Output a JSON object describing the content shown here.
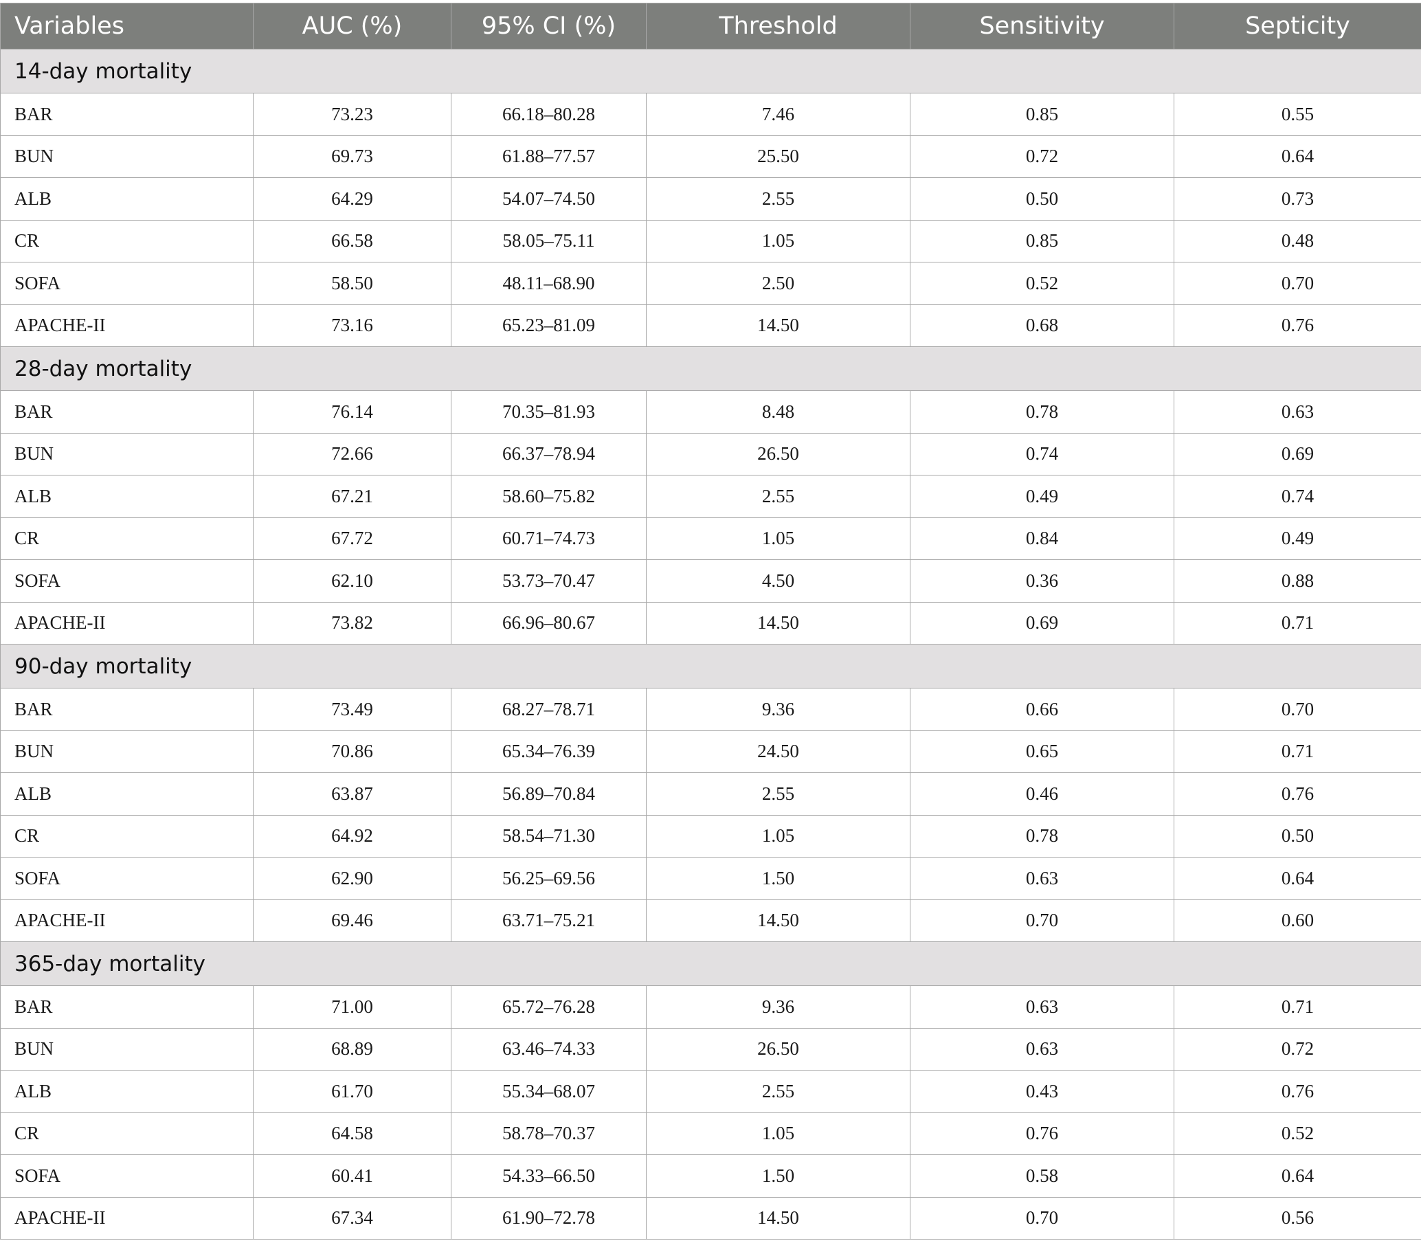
{
  "table": {
    "headers": [
      "Variables",
      "AUC (%)",
      "95% CI (%)",
      "Threshold",
      "Sensitivity",
      "Septicity"
    ],
    "groups": [
      {
        "label": "14-day mortality",
        "rows": [
          [
            "BAR",
            "73.23",
            "66.18–80.28",
            "7.46",
            "0.85",
            "0.55"
          ],
          [
            "BUN",
            "69.73",
            "61.88–77.57",
            "25.50",
            "0.72",
            "0.64"
          ],
          [
            "ALB",
            "64.29",
            "54.07–74.50",
            "2.55",
            "0.50",
            "0.73"
          ],
          [
            "CR",
            "66.58",
            "58.05–75.11",
            "1.05",
            "0.85",
            "0.48"
          ],
          [
            "SOFA",
            "58.50",
            "48.11–68.90",
            "2.50",
            "0.52",
            "0.70"
          ],
          [
            "APACHE-II",
            "73.16",
            "65.23–81.09",
            "14.50",
            "0.68",
            "0.76"
          ]
        ]
      },
      {
        "label": "28-day mortality",
        "rows": [
          [
            "BAR",
            "76.14",
            "70.35–81.93",
            "8.48",
            "0.78",
            "0.63"
          ],
          [
            "BUN",
            "72.66",
            "66.37–78.94",
            "26.50",
            "0.74",
            "0.69"
          ],
          [
            "ALB",
            "67.21",
            "58.60–75.82",
            "2.55",
            "0.49",
            "0.74"
          ],
          [
            "CR",
            "67.72",
            "60.71–74.73",
            "1.05",
            "0.84",
            "0.49"
          ],
          [
            "SOFA",
            "62.10",
            "53.73–70.47",
            "4.50",
            "0.36",
            "0.88"
          ],
          [
            "APACHE-II",
            "73.82",
            "66.96–80.67",
            "14.50",
            "0.69",
            "0.71"
          ]
        ]
      },
      {
        "label": "90-day mortality",
        "rows": [
          [
            "BAR",
            "73.49",
            "68.27–78.71",
            "9.36",
            "0.66",
            "0.70"
          ],
          [
            "BUN",
            "70.86",
            "65.34–76.39",
            "24.50",
            "0.65",
            "0.71"
          ],
          [
            "ALB",
            "63.87",
            "56.89–70.84",
            "2.55",
            "0.46",
            "0.76"
          ],
          [
            "CR",
            "64.92",
            "58.54–71.30",
            "1.05",
            "0.78",
            "0.50"
          ],
          [
            "SOFA",
            "62.90",
            "56.25–69.56",
            "1.50",
            "0.63",
            "0.64"
          ],
          [
            "APACHE-II",
            "69.46",
            "63.71–75.21",
            "14.50",
            "0.70",
            "0.60"
          ]
        ]
      },
      {
        "label": "365-day mortality",
        "rows": [
          [
            "BAR",
            "71.00",
            "65.72–76.28",
            "9.36",
            "0.63",
            "0.71"
          ],
          [
            "BUN",
            "68.89",
            "63.46–74.33",
            "26.50",
            "0.63",
            "0.72"
          ],
          [
            "ALB",
            "61.70",
            "55.34–68.07",
            "2.55",
            "0.43",
            "0.76"
          ],
          [
            "CR",
            "64.58",
            "58.78–70.37",
            "1.05",
            "0.76",
            "0.52"
          ],
          [
            "SOFA",
            "60.41",
            "54.33–66.50",
            "1.50",
            "0.58",
            "0.64"
          ],
          [
            "APACHE-II",
            "67.34",
            "61.90–72.78",
            "14.50",
            "0.70",
            "0.56"
          ]
        ]
      }
    ]
  }
}
